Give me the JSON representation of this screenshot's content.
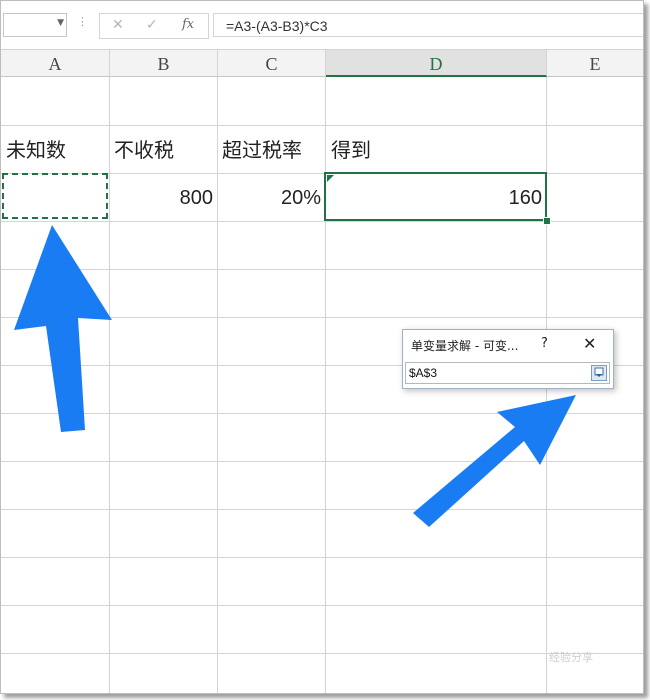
{
  "formula_bar": {
    "name_box": "",
    "fx_label": "fx",
    "formula": "=A3-(A3-B3)*C3"
  },
  "columns": [
    "A",
    "B",
    "C",
    "D",
    "E"
  ],
  "active_column": "D",
  "rows": {
    "headers": {
      "A": "未知数",
      "B": "不收税",
      "C": "超过税率",
      "D": "得到"
    },
    "values": {
      "A": "",
      "B": "800",
      "C": "20%",
      "D": "160"
    }
  },
  "dialog": {
    "title": "单变量求解 - 可变...",
    "help": "?",
    "close": "✕",
    "input_value": "$A$3"
  },
  "watermark": "经验分享",
  "colors": {
    "accent": "#217346",
    "arrow": "#1a7cf2"
  }
}
